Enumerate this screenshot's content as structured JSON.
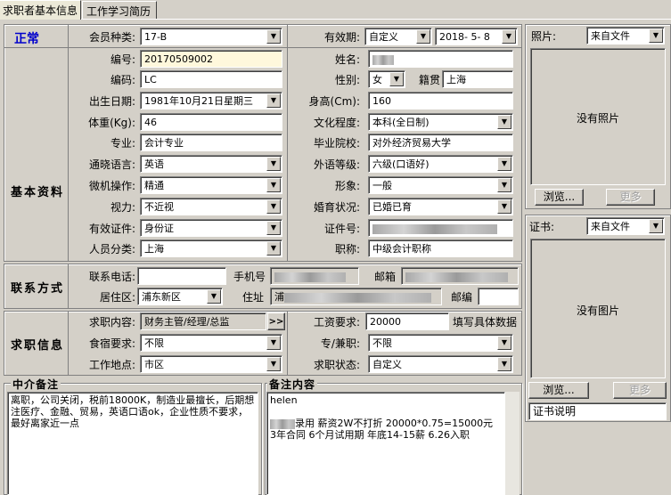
{
  "tabs": [
    "求职者基本信息",
    "工作学习简历"
  ],
  "status": "正常",
  "sections": {
    "basic": "基本资料",
    "contact": "联系方式",
    "job": "求职信息"
  },
  "fields": {
    "member_type": {
      "label": "会员种类:",
      "value": "17-B"
    },
    "validity": {
      "label": "有效期:",
      "mode": "自定义",
      "date": "2018- 5- 8"
    },
    "number": {
      "label": "编号:",
      "value": "20170509002"
    },
    "name": {
      "label": "姓名:"
    },
    "code": {
      "label": "编码:",
      "value": "LC"
    },
    "gender": {
      "label": "性别:",
      "value": "女"
    },
    "native": {
      "label": "籍贯",
      "value": "上海"
    },
    "birth": {
      "label": "出生日期:",
      "value": "1981年10月21日星期三"
    },
    "height": {
      "label": "身高(Cm):",
      "value": "160"
    },
    "weight": {
      "label": "体重(Kg):",
      "value": "46"
    },
    "education": {
      "label": "文化程度:",
      "value": "本科(全日制)"
    },
    "major": {
      "label": "专业:",
      "value": "会计专业"
    },
    "school": {
      "label": "毕业院校:",
      "value": "对外经济贸易大学"
    },
    "language": {
      "label": "通晓语言:",
      "value": "英语"
    },
    "lang_level": {
      "label": "外语等级:",
      "value": "六级(口语好)"
    },
    "computer": {
      "label": "微机操作:",
      "value": "精通"
    },
    "image": {
      "label": "形象:",
      "value": "一般"
    },
    "vision": {
      "label": "视力:",
      "value": "不近视"
    },
    "marriage": {
      "label": "婚育状况:",
      "value": "已婚已育"
    },
    "id_type": {
      "label": "有效证件:",
      "value": "身份证"
    },
    "id_no": {
      "label": "证件号:"
    },
    "category": {
      "label": "人员分类:",
      "value": "上海"
    },
    "title": {
      "label": "职称:",
      "value": "中级会计职称"
    },
    "phone": {
      "label": "联系电话:"
    },
    "mobile": {
      "label": "手机号"
    },
    "email": {
      "label": "邮箱"
    },
    "district": {
      "label": "居住区:",
      "value": "浦东新区"
    },
    "address": {
      "label": "住址",
      "prefix": "浦"
    },
    "zip": {
      "label": "邮编"
    },
    "job_want": {
      "label": "求职内容:",
      "value": "财务主管/经理/总监",
      "more": ">>"
    },
    "salary": {
      "label": "工资要求:",
      "value": "20000",
      "hint": "填写具体数据"
    },
    "board": {
      "label": "食宿要求:",
      "value": "不限"
    },
    "parttime": {
      "label": "专/兼职:",
      "value": "不限"
    },
    "location": {
      "label": "工作地点:",
      "value": "市区"
    },
    "job_status": {
      "label": "求职状态:",
      "value": "自定义"
    }
  },
  "photo": {
    "label": "照片:",
    "source": "来自文件",
    "empty": "没有照片",
    "browse": "浏览...",
    "more": "更多"
  },
  "cert": {
    "label": "证书:",
    "source": "来自文件",
    "empty": "没有图片",
    "browse": "浏览...",
    "more": "更多",
    "desc": "证书说明"
  },
  "agency_note": {
    "title": "中介备注",
    "text": "离职，公司关闭，税前18000K，制造业最擅长，后期想注医疗、金融、贸易，英语口语ok，企业性质不要求，最好离家近一点"
  },
  "remark": {
    "title": "备注内容",
    "line1": "helen",
    "line2": "录用 薪资2W不打折 20000*0.75=15000元 3年合同 6个月试用期 年底14-15薪 6.26入职"
  },
  "colors": {
    "status": "#0000cc",
    "input_highlight": "#fff8dc",
    "panel": "#d4d0c8"
  }
}
